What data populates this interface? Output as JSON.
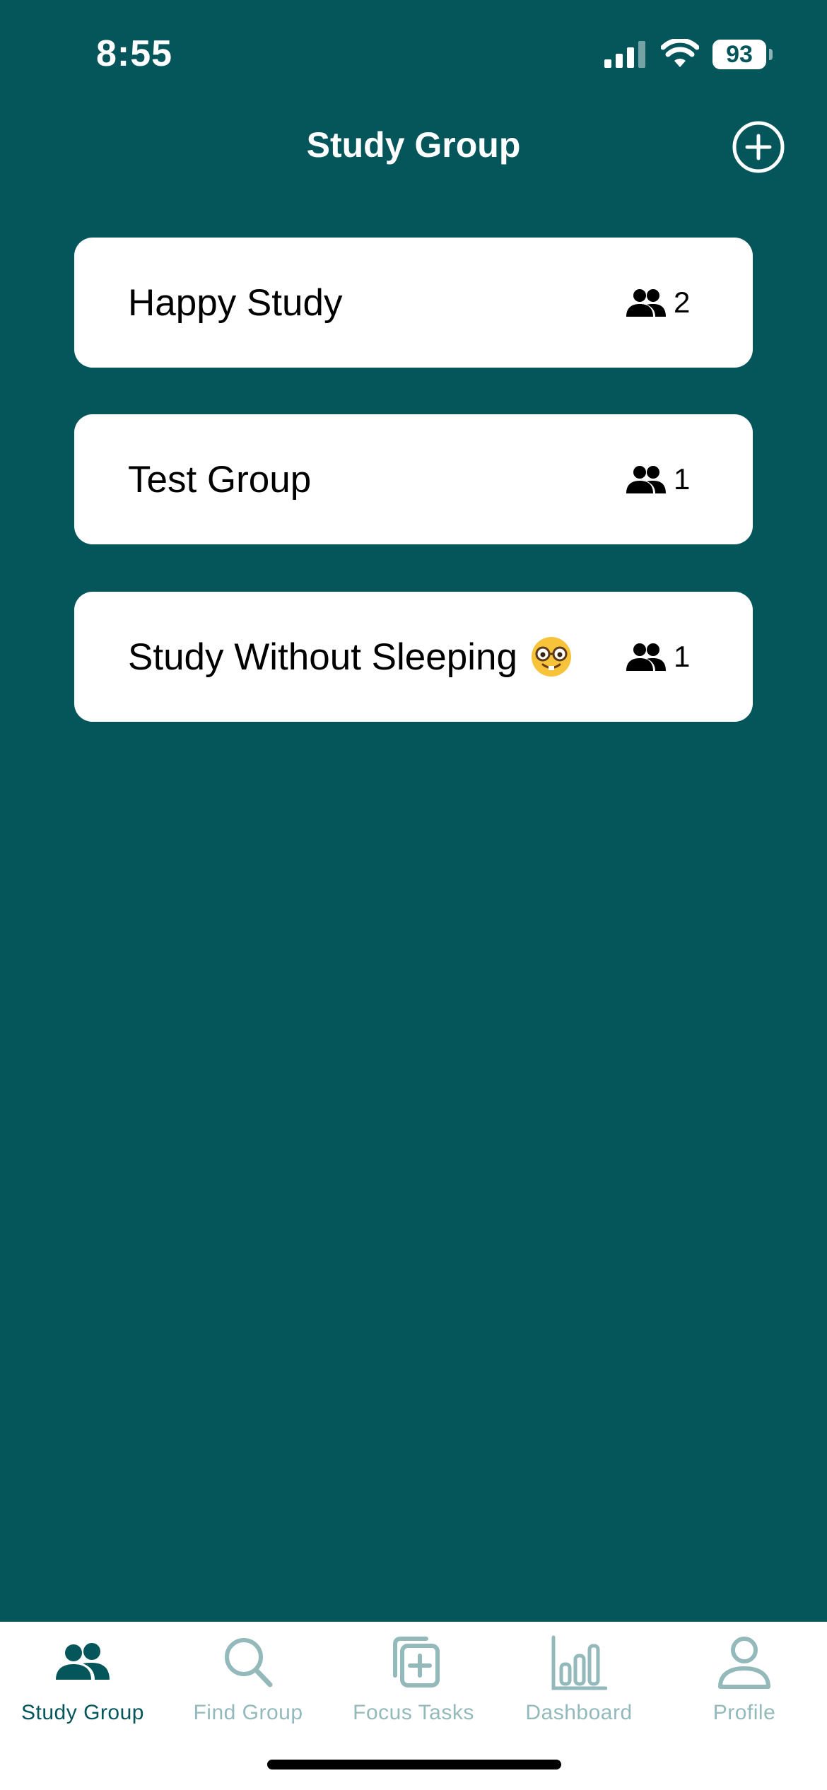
{
  "status_bar": {
    "time": "8:55",
    "battery_level": "93",
    "icons": [
      "cellular-signal-icon",
      "wifi-icon",
      "battery-icon"
    ]
  },
  "header": {
    "title": "Study Group",
    "add_icon": "plus-circle-icon"
  },
  "groups": [
    {
      "name": "Happy Study",
      "members": "2"
    },
    {
      "name": "Test Group",
      "members": "1"
    },
    {
      "name": "Study Without Sleeping",
      "emoji_icon": "nerd-face-icon",
      "members": "1"
    }
  ],
  "tab_bar": {
    "active_index": 0,
    "tabs": [
      {
        "label": "Study Group",
        "icon": "people-icon"
      },
      {
        "label": "Find Group",
        "icon": "search-icon"
      },
      {
        "label": "Focus Tasks",
        "icon": "add-stack-icon"
      },
      {
        "label": "Dashboard",
        "icon": "bar-chart-icon"
      },
      {
        "label": "Profile",
        "icon": "person-icon"
      }
    ]
  },
  "colors": {
    "background": "#04565b",
    "card": "#ffffff",
    "tab_active": "#04565b",
    "tab_inactive": "#93b9bb"
  }
}
